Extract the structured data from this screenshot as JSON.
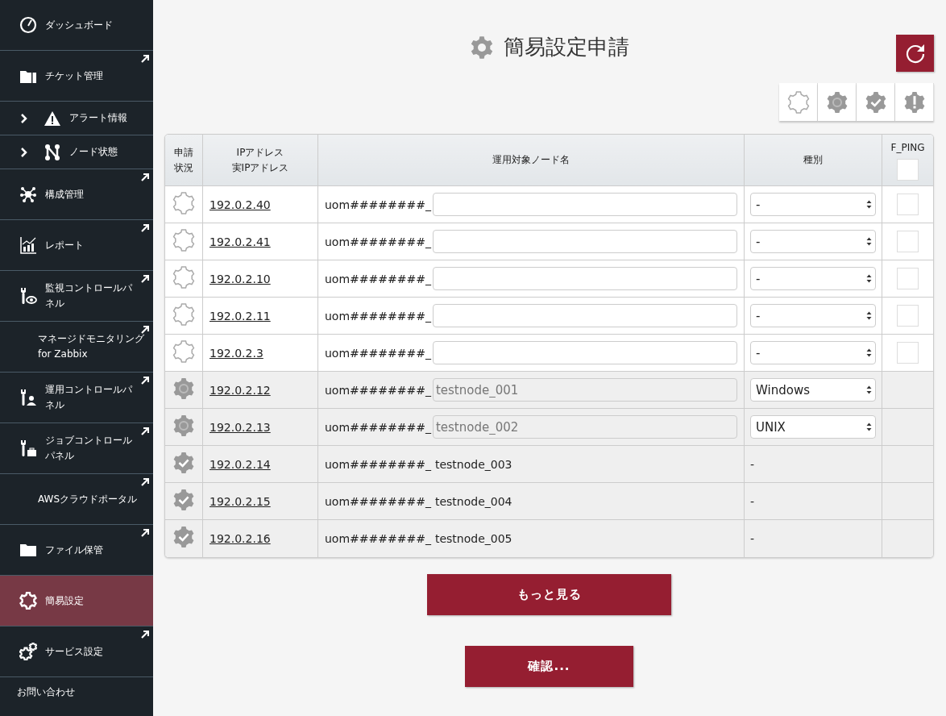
{
  "sidebar": {
    "items": [
      {
        "label": "ダッシュボード",
        "kind": "gauge",
        "external": false,
        "expandable": false,
        "selected": false
      },
      {
        "label": "チケット管理",
        "kind": "ticket",
        "external": true,
        "expandable": false,
        "selected": false
      },
      {
        "label": "アラート情報",
        "kind": "alert",
        "external": false,
        "expandable": true,
        "selected": false
      },
      {
        "label": "ノード状態",
        "kind": "node",
        "external": false,
        "expandable": true,
        "selected": false
      },
      {
        "label": "構成管理",
        "kind": "config",
        "external": true,
        "expandable": false,
        "selected": false
      },
      {
        "label": "レポート",
        "kind": "report",
        "external": true,
        "expandable": false,
        "selected": false
      },
      {
        "label": "監視コントロールパネル",
        "kind": "monitor",
        "external": true,
        "expandable": false,
        "selected": false
      },
      {
        "label": "マネージドモニタリング for Zabbix",
        "kind": "plain",
        "external": true,
        "expandable": false,
        "selected": false
      },
      {
        "label": "運用コントロールパネル",
        "kind": "operation",
        "external": true,
        "expandable": false,
        "selected": false
      },
      {
        "label": "ジョブコントロールパネル",
        "kind": "job",
        "external": true,
        "expandable": false,
        "selected": false
      },
      {
        "label": "AWSクラウドポータル",
        "kind": "plain",
        "external": true,
        "expandable": false,
        "selected": false
      },
      {
        "label": "ファイル保管",
        "kind": "files",
        "external": true,
        "expandable": false,
        "selected": false
      },
      {
        "label": "簡易設定",
        "kind": "setting",
        "external": false,
        "expandable": false,
        "selected": true
      },
      {
        "label": "サービス設定",
        "kind": "service",
        "external": true,
        "expandable": false,
        "selected": false
      }
    ],
    "footer": "お問い合わせ"
  },
  "page": {
    "title": "簡易設定申請"
  },
  "legend": [
    {
      "kind": "new"
    },
    {
      "kind": "pending"
    },
    {
      "kind": "done"
    },
    {
      "kind": "error"
    }
  ],
  "table": {
    "columns": [
      {
        "label": "申請状況"
      },
      {
        "label": "IPアドレス",
        "sublabel": "実IPアドレス"
      },
      {
        "label": "運用対象ノード名"
      },
      {
        "label": "種別"
      },
      {
        "label": "F_PING",
        "checked": false
      }
    ],
    "rows": [
      {
        "kind": "new",
        "ip": "192.0.2.40",
        "prefix": "uom########_",
        "type": "-",
        "ping": false
      },
      {
        "kind": "new",
        "ip": "192.0.2.41",
        "prefix": "uom########_",
        "type": "-",
        "ping": false
      },
      {
        "kind": "new",
        "ip": "192.0.2.10",
        "prefix": "uom########_",
        "type": "-",
        "ping": false
      },
      {
        "kind": "new",
        "ip": "192.0.2.11",
        "prefix": "uom########_",
        "type": "-",
        "ping": false
      },
      {
        "kind": "new",
        "ip": "192.0.2.3",
        "prefix": "uom########_",
        "type": "-",
        "ping": false
      },
      {
        "kind": "pending",
        "ip": "192.0.2.12",
        "prefix": "uom########_",
        "name": "testnode_001",
        "type": "Windows"
      },
      {
        "kind": "pending",
        "ip": "192.0.2.13",
        "prefix": "uom########_",
        "name": "testnode_002",
        "type": "UNIX"
      },
      {
        "kind": "done",
        "ip": "192.0.2.14",
        "prefix": "uom########_",
        "name": "testnode_003",
        "type": "-"
      },
      {
        "kind": "done",
        "ip": "192.0.2.15",
        "prefix": "uom########_",
        "name": "testnode_004",
        "type": "-"
      },
      {
        "kind": "done",
        "ip": "192.0.2.16",
        "prefix": "uom########_",
        "name": "testnode_005",
        "type": "-"
      }
    ]
  },
  "buttons": [
    {
      "label": "もっと見る"
    },
    {
      "label": "確認..."
    }
  ]
}
